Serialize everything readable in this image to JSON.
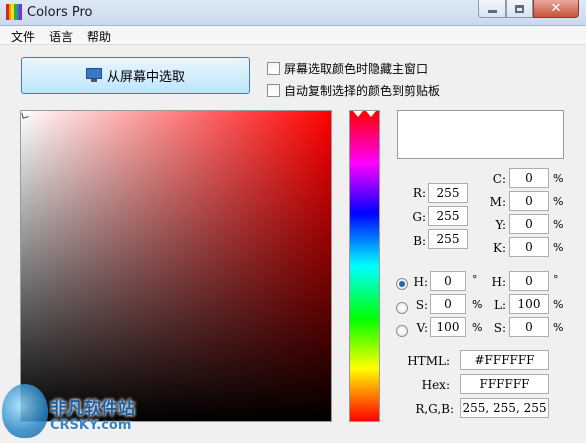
{
  "window": {
    "title": "Colors Pro",
    "close_glyph": "✕"
  },
  "menu": [
    "文件",
    "语言",
    "帮助"
  ],
  "pick_button": {
    "label": "从屏幕中选取",
    "icon": "monitor-icon"
  },
  "options": [
    {
      "label": "屏幕选取颜色时隐藏主窗口",
      "checked": false
    },
    {
      "label": "自动复制选择的颜色到剪贴板",
      "checked": false
    }
  ],
  "color": {
    "selected_hex": "#FFFFFF",
    "rgb": {
      "r": {
        "label": "R:",
        "value": "255"
      },
      "g": {
        "label": "G:",
        "value": "255"
      },
      "b": {
        "label": "B:",
        "value": "255"
      }
    },
    "cmyk": {
      "c": {
        "label": "C:",
        "value": "0",
        "unit": "%"
      },
      "m": {
        "label": "M:",
        "value": "0",
        "unit": "%"
      },
      "y": {
        "label": "Y:",
        "value": "0",
        "unit": "%"
      },
      "k": {
        "label": "K:",
        "value": "0",
        "unit": "%"
      }
    },
    "hsv": {
      "h": {
        "label": "H:",
        "value": "0",
        "unit": "°"
      },
      "s": {
        "label": "S:",
        "value": "0",
        "unit": "%"
      },
      "v": {
        "label": "V:",
        "value": "100",
        "unit": "%"
      }
    },
    "hsl": {
      "h": {
        "label": "H:",
        "value": "0",
        "unit": "°"
      },
      "l": {
        "label": "L:",
        "value": "100",
        "unit": "%"
      },
      "s": {
        "label": "S:",
        "value": "0",
        "unit": "%"
      }
    },
    "html": {
      "label": "HTML:",
      "value": "#FFFFFF"
    },
    "hex": {
      "label": "Hex:",
      "value": "FFFFFF"
    },
    "rgb_list": {
      "label": "R,G,B:",
      "value": "255, 255, 255"
    }
  },
  "radio_selected": "hsv-h",
  "watermark": {
    "zh": "非凡软件站",
    "en": "CRSKY.com"
  }
}
